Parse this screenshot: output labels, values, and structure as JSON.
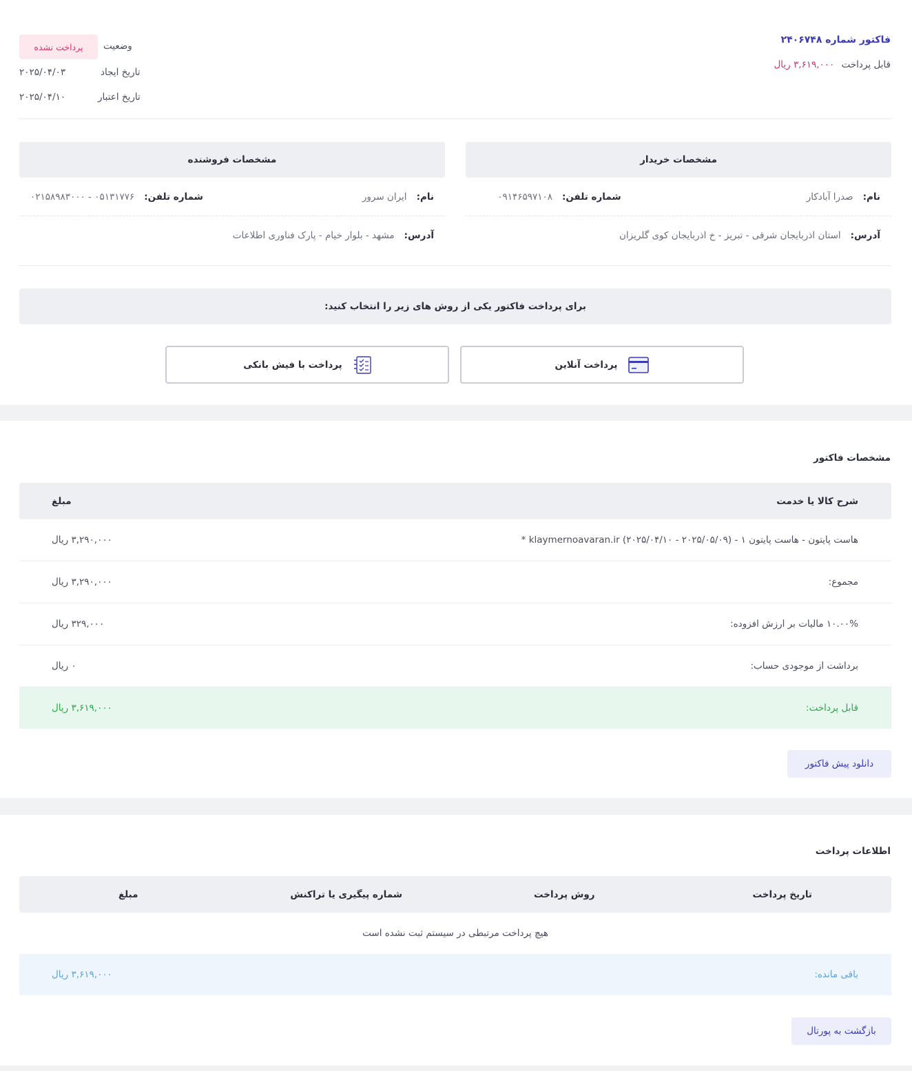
{
  "header": {
    "invoice_title": "فاکتور شماره ۲۴۰۶۷۴۸",
    "payable_label": "قابل پرداخت",
    "payable_amount": "۳,۶۱۹,۰۰۰ ریال",
    "status_label": "وضعیت",
    "status_value": "پرداخت نشده",
    "created_label": "تاریخ ایجاد",
    "created_value": "۲۰۲۵/۰۴/۰۳",
    "valid_label": "تاریخ اعتبار",
    "valid_value": "۲۰۲۵/۰۴/۱۰"
  },
  "buyer": {
    "title": "مشخصات خریدار",
    "name_label": "نام:",
    "name": "صدرا آبادکار",
    "phone_label": "شماره تلفن:",
    "phone": "۰۹۱۴۶۵۹۷۱۰۸",
    "address_label": "آدرس:",
    "address": "استان اذربایجان شرقی - تبریز - خ اذربایجان کوی گلریزان"
  },
  "seller": {
    "title": "مشخصات فروشنده",
    "name_label": "نام:",
    "name": "ایران سرور",
    "phone_label": "شماره تلفن:",
    "phone": "۰۵۱۳۱۷۷۶ - ۰۲۱۵۸۹۸۳۰۰۰",
    "address_label": "آدرس:",
    "address": "مشهد - بلوار خیام - پارک فناوری اطلاعات"
  },
  "payment_methods": {
    "banner": "برای پرداخت فاکتور یکی از روش های زیر را انتخاب کنید:",
    "online_label": "پرداخت آنلاین",
    "online_icon": "credit-card-icon",
    "slip_label": "پرداخت با فیش بانکی",
    "slip_icon": "checklist-icon"
  },
  "invoice_details": {
    "title": "مشخصات فاکتور",
    "col_desc": "شرح کالا یا خدمت",
    "col_amount": "مبلغ",
    "rows": [
      {
        "desc": "هاست پایتون - هاست پایتون ۱ - (۲۰۲۵/۰۵/۰۹ - ۲۰۲۵/۰۴/۱۰) klaymernoavaran.ir *",
        "amount": "۳,۲۹۰,۰۰۰ ریال"
      },
      {
        "desc": "مجموع:",
        "amount": "۳,۲۹۰,۰۰۰ ریال"
      },
      {
        "desc": "۱۰.۰۰% مالیات بر ارزش افزوده:",
        "amount": "۳۲۹,۰۰۰ ریال"
      },
      {
        "desc": "برداشت از موجودی حساب:",
        "amount": "۰ ریال"
      }
    ],
    "total_label": "قابل پرداخت:",
    "total_amount": "۳,۶۱۹,۰۰۰ ریال",
    "download_button": "دانلود پیش فاکتور"
  },
  "payment_info": {
    "title": "اطلاعات پرداخت",
    "columns": [
      "تاریخ پرداخت",
      "روش پرداخت",
      "شماره پیگیری یا تراکنش",
      "مبلغ"
    ],
    "empty_message": "هیچ پرداخت مرتبطی در سیستم ثبت نشده است",
    "remaining_label": "باقی مانده:",
    "remaining_amount": "۳,۶۱۹,۰۰۰ ریال",
    "portal_button": "بازگشت به پورتال"
  },
  "colors": {
    "accent": "#3b3bb3",
    "unpaid": "#d6336c",
    "total_green": "#28a745",
    "remaining_blue": "#5aa1e0"
  }
}
